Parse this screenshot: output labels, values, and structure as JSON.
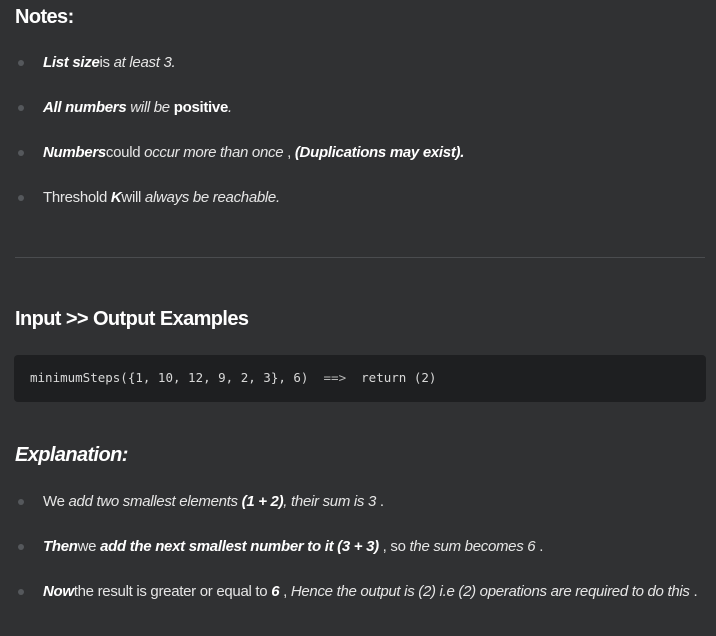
{
  "notes": {
    "heading": "Notes:",
    "items": [
      {
        "parts": [
          {
            "text": "List size",
            "style": "bi"
          },
          {
            "text": "is ",
            "style": "n"
          },
          {
            "text": "at least 3.",
            "style": "i"
          }
        ]
      },
      {
        "parts": [
          {
            "text": "All numbers",
            "style": "bi"
          },
          {
            "text": " will be ",
            "style": "i"
          },
          {
            "text": "positive",
            "style": "b"
          },
          {
            "text": ".",
            "style": "i"
          }
        ]
      },
      {
        "parts": [
          {
            "text": "Numbers",
            "style": "bi"
          },
          {
            "text": "could ",
            "style": "n"
          },
          {
            "text": "occur more than once",
            "style": "i"
          },
          {
            "text": " , ",
            "style": "n"
          },
          {
            "text": "(Duplications may exist).",
            "style": "bi"
          }
        ]
      },
      {
        "parts": [
          {
            "text": "Threshold ",
            "style": "n"
          },
          {
            "text": "K",
            "style": "bi"
          },
          {
            "text": "will ",
            "style": "n"
          },
          {
            "text": "always be reachable.",
            "style": "i"
          }
        ]
      }
    ]
  },
  "io_section": {
    "heading": "Input >> Output Examples",
    "code_call": "minimumSteps({1, 10, 12, 9, 2, 3}, 6)",
    "code_arrow": "==>",
    "code_return": "return (2)"
  },
  "explanation": {
    "heading": "Explanation:",
    "items": [
      {
        "parts": [
          {
            "text": "We ",
            "style": "n"
          },
          {
            "text": "add two smallest elements ",
            "style": "i"
          },
          {
            "text": "(1 + 2)",
            "style": "bi"
          },
          {
            "text": ", their sum is 3",
            "style": "i"
          },
          {
            "text": " .",
            "style": "n"
          }
        ]
      },
      {
        "parts": [
          {
            "text": "Then",
            "style": "bi"
          },
          {
            "text": "we ",
            "style": "n"
          },
          {
            "text": "add the next smallest number to it ",
            "style": "bi"
          },
          {
            "text": "(3 + 3)",
            "style": "bi"
          },
          {
            "text": " , so ",
            "style": "n"
          },
          {
            "text": "the sum becomes 6",
            "style": "i"
          },
          {
            "text": " .",
            "style": "n"
          }
        ]
      },
      {
        "parts": [
          {
            "text": "Now",
            "style": "bi"
          },
          {
            "text": "the result is greater or equal to ",
            "style": "n"
          },
          {
            "text": "6",
            "style": "bi"
          },
          {
            "text": " , ",
            "style": "n"
          },
          {
            "text": "Hence the output is (2) i.e (2) operations are required to do this",
            "style": "i"
          },
          {
            "text": " .",
            "style": "n"
          }
        ]
      }
    ]
  }
}
